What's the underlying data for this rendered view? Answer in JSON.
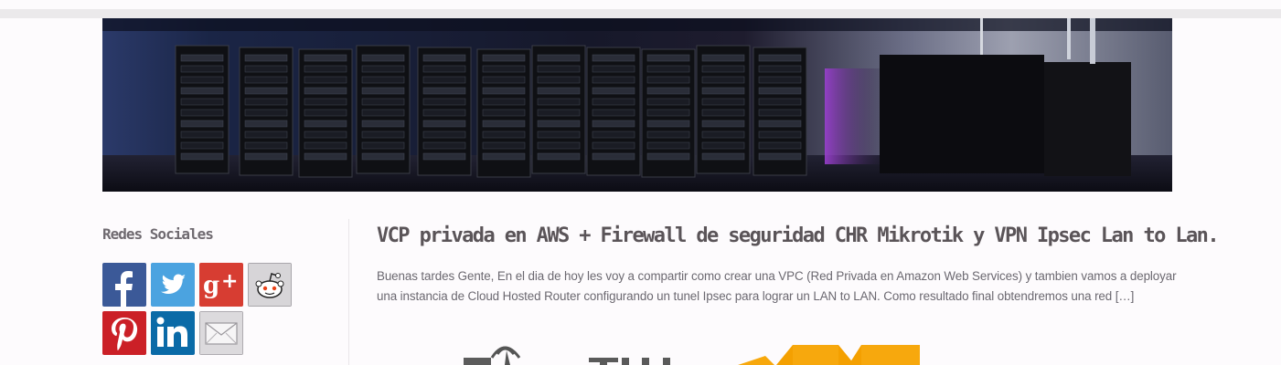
{
  "sidebar": {
    "widget_title": "Redes Sociales",
    "social_icons": [
      "facebook-icon",
      "twitter-icon",
      "google-plus-icon",
      "reddit-icon",
      "pinterest-icon",
      "linkedin-icon",
      "email-icon"
    ]
  },
  "post": {
    "title": "VCP privada en AWS + Firewall de seguridad CHR Mikrotik y VPN Ipsec Lan to Lan.",
    "excerpt": "  Buenas tardes Gente, En el dia de hoy les voy a compartir como crear una VPC (Red Privada en Amazon Web Services) y tambien vamos a deployar una instancia de Cloud Hosted Router configurando un tunel Ipsec para lograr un LAN to LAN. Como resultado final obtendremos una red […]"
  },
  "colors": {
    "background": "#fdfbfd",
    "title": "#5a5458",
    "text": "#6b6870",
    "facebook": "#3b5998",
    "twitter": "#4ba3e0",
    "google_plus": "#d73d32",
    "pinterest": "#cb2027",
    "linkedin": "#0a6aa7",
    "aws_orange": "#f7a80d"
  }
}
